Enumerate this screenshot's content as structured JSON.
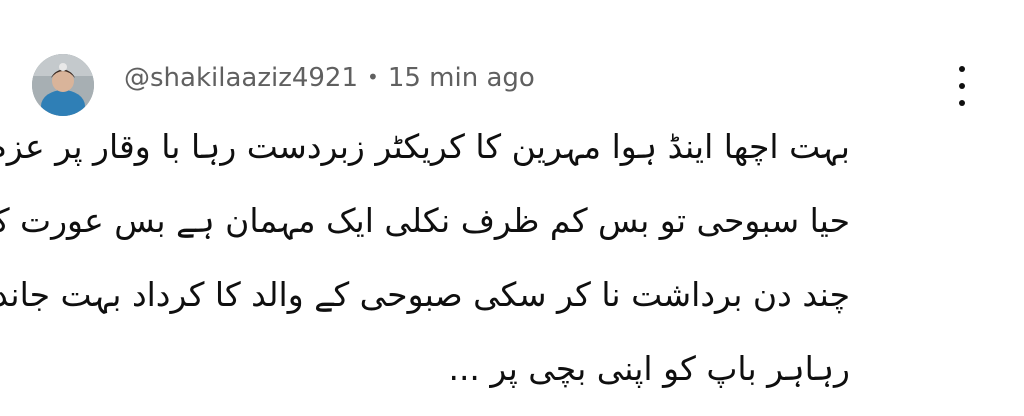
{
  "comment": {
    "author": "@shakilaaziz4921",
    "separator": "•",
    "timestamp": "15 min ago",
    "avatar_icon": "user-avatar-photo",
    "menu_icon": "more-vertical-icon",
    "text_lines": [
      "بہت اچھا اینڈ ہوا مہرین کا کریکٹر زبردست رہا با وقار پر عزم با",
      "حیا سبوحی تو بس کم ظرف نکلی ایک مہمان ہے بس عورت کو",
      "چند دن برداشت نا کر سکی صبوحی کے والد کا کرداد بہت جاندار",
      "رہاہر باپ کو اپنی بچی پر ..."
    ]
  },
  "colors": {
    "meta_text": "#606060",
    "body_text": "#0f0f0f",
    "background": "#ffffff"
  }
}
